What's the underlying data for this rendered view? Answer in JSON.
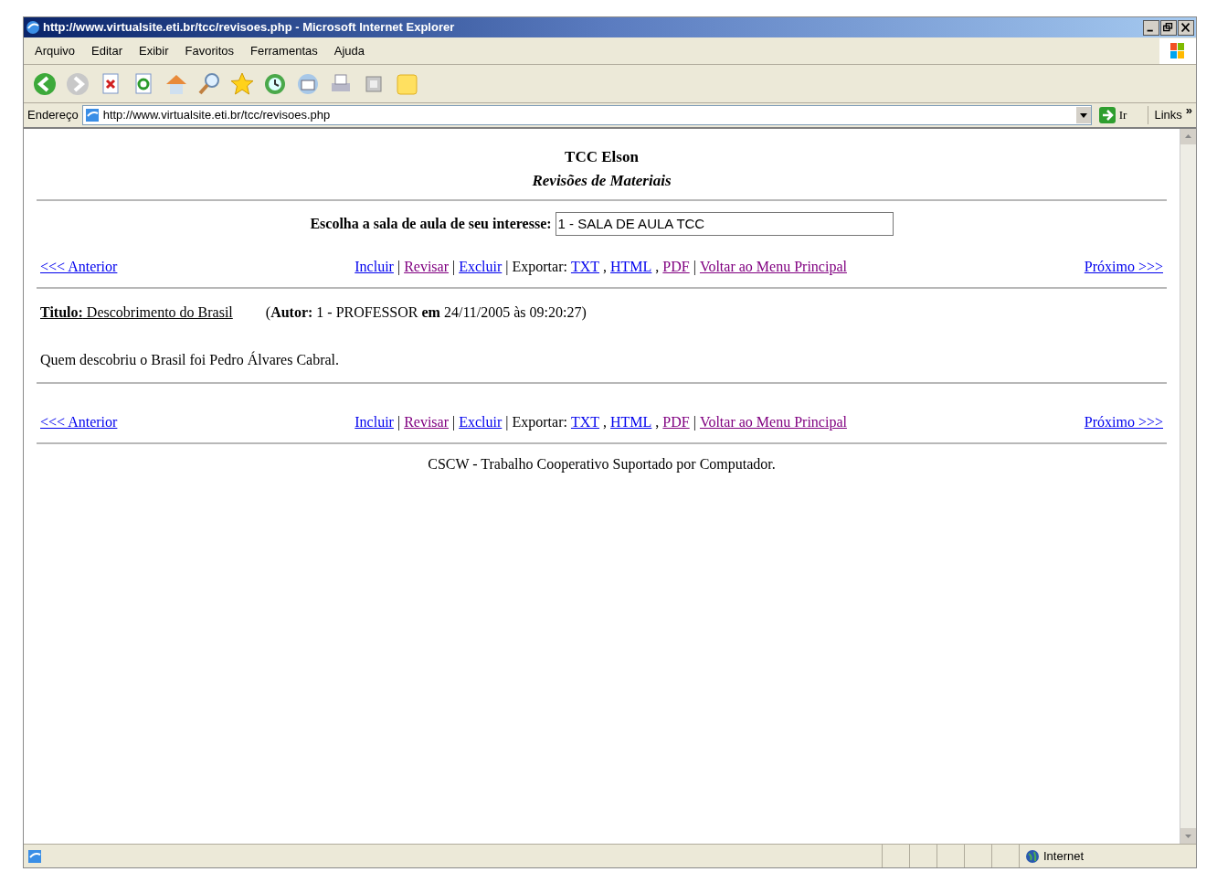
{
  "window": {
    "title": "http://www.virtualsite.eti.br/tcc/revisoes.php - Microsoft Internet Explorer"
  },
  "menu": [
    "Arquivo",
    "Editar",
    "Exibir",
    "Favoritos",
    "Ferramentas",
    "Ajuda"
  ],
  "address_bar": {
    "label": "Endereço",
    "url": "http://www.virtualsite.eti.br/tcc/revisoes.php",
    "go": "Ir",
    "links": "Links",
    "chevron": "»"
  },
  "page": {
    "title": "TCC Elson",
    "subtitle": "Revisões de Materiais",
    "room_label": "Escolha a sala de aula de seu interesse:",
    "room_value": "1 - SALA DE AULA TCC",
    "nav_top": {
      "previous": {
        "text": "<<< Anterior",
        "visited": false
      },
      "next": {
        "text": "Próximo >>>",
        "visited": false
      },
      "items": [
        {
          "kind": "link",
          "text": "Incluir",
          "visited": false
        },
        {
          "kind": "text",
          "text": "|"
        },
        {
          "kind": "link",
          "text": "Revisar",
          "visited": true
        },
        {
          "kind": "text",
          "text": "|"
        },
        {
          "kind": "link",
          "text": "Excluir",
          "visited": false
        },
        {
          "kind": "text",
          "text": "| Exportar:"
        },
        {
          "kind": "link",
          "text": "TXT",
          "visited": false
        },
        {
          "kind": "text",
          "text": ","
        },
        {
          "kind": "link",
          "text": "HTML",
          "visited": false
        },
        {
          "kind": "text",
          "text": ","
        },
        {
          "kind": "link",
          "text": "PDF",
          "visited": true
        },
        {
          "kind": "text",
          "text": "|"
        },
        {
          "kind": "link",
          "text": "Voltar ao Menu Principal",
          "visited": true
        }
      ]
    },
    "entry_title": "**Titulo:** Descobrimento do Brasil",
    "entry_author": "(**Autor:** 1 - PROFESSOR **em** 24/11/2005 às 09:20:27)",
    "entry_body": "Quem descobriu o Brasil foi Pedro Álvares Cabral.",
    "nav_bottom": {
      "previous": {
        "text": "<<< Anterior",
        "visited": false
      },
      "next": {
        "text": "Próximo >>>",
        "visited": false
      },
      "items": [
        {
          "kind": "link",
          "text": "Incluir",
          "visited": false
        },
        {
          "kind": "text",
          "text": "|"
        },
        {
          "kind": "link",
          "text": "Revisar",
          "visited": true
        },
        {
          "kind": "text",
          "text": "|"
        },
        {
          "kind": "link",
          "text": "Excluir",
          "visited": false
        },
        {
          "kind": "text",
          "text": "| Exportar:"
        },
        {
          "kind": "link",
          "text": "TXT",
          "visited": false
        },
        {
          "kind": "text",
          "text": ","
        },
        {
          "kind": "link",
          "text": "HTML",
          "visited": false
        },
        {
          "kind": "text",
          "text": ","
        },
        {
          "kind": "link",
          "text": "PDF",
          "visited": true
        },
        {
          "kind": "text",
          "text": "|"
        },
        {
          "kind": "link",
          "text": "Voltar ao Menu Principal",
          "visited": true
        }
      ]
    },
    "footer": "CSCW - Trabalho Cooperativo Suportado por Computador."
  },
  "status_bar": {
    "zone": "Internet"
  }
}
